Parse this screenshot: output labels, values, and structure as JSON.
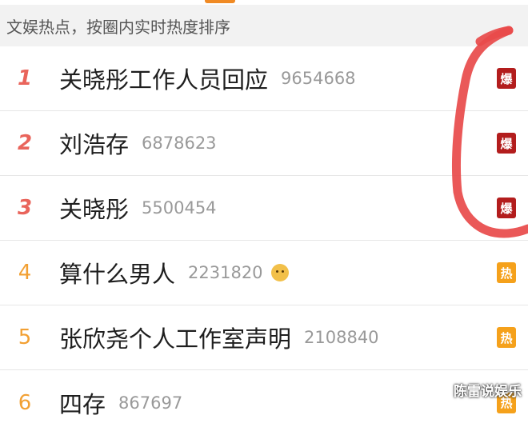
{
  "header": {
    "text": "文娱热点，按圈内实时热度排序"
  },
  "items": [
    {
      "rank": "1",
      "title": "关晓彤工作人员回应",
      "count": "9654668",
      "badge": "爆"
    },
    {
      "rank": "2",
      "title": "刘浩存",
      "count": "6878623",
      "badge": "爆"
    },
    {
      "rank": "3",
      "title": "关晓彤",
      "count": "5500454",
      "badge": "爆"
    },
    {
      "rank": "4",
      "title": "算什么男人",
      "count": "2231820",
      "badge": "热"
    },
    {
      "rank": "5",
      "title": "张欣尧个人工作室声明",
      "count": "2108840",
      "badge": "热"
    },
    {
      "rank": "6",
      "title": "四存",
      "count": "867697",
      "badge": "热"
    }
  ],
  "watermark": "陈雷说娱乐",
  "colors": {
    "top_rank": "#e9645b",
    "rank": "#f2a033",
    "hot_badge": "#b31d1d",
    "warm_badge": "#f5a11b",
    "annotation": "#e84a4a"
  }
}
